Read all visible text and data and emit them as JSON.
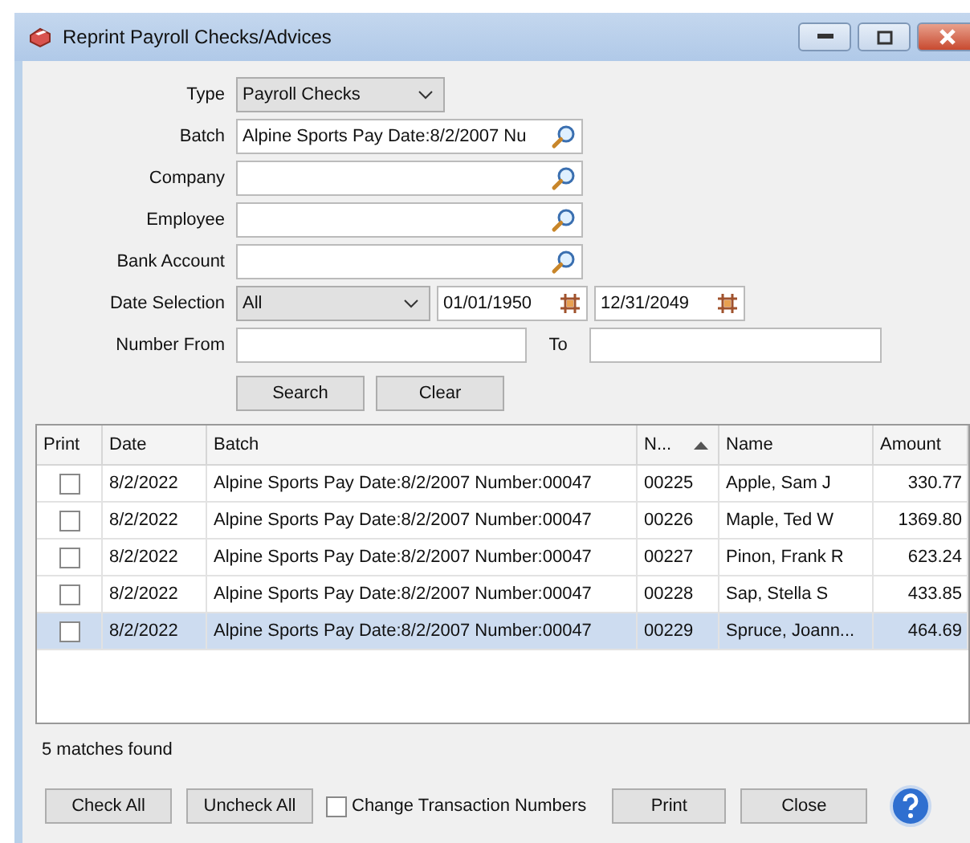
{
  "window": {
    "title": "Reprint Payroll Checks/Advices"
  },
  "form": {
    "type": {
      "label": "Type",
      "value": "Payroll Checks"
    },
    "lookups": [
      {
        "label": "Batch",
        "value": "Alpine Sports Pay Date:8/2/2007 Nu"
      },
      {
        "label": "Company"
      },
      {
        "label": "Employee"
      },
      {
        "label": "Bank Account"
      }
    ],
    "date_selection": {
      "label": "Date Selection",
      "value": "All",
      "from": "01/01/1950",
      "to": "12/31/2049"
    },
    "number": {
      "label": "Number From",
      "to_label": "To"
    },
    "buttons": [
      "Search",
      "Clear"
    ]
  },
  "table": {
    "columns": [
      {
        "label": "Print",
        "sorted": false
      },
      {
        "label": "Date",
        "sorted": false
      },
      {
        "label": "Batch",
        "sorted": false
      },
      {
        "label": "N...",
        "sorted": true
      },
      {
        "label": "Name",
        "sorted": false
      },
      {
        "label": "Amount",
        "sorted": false
      }
    ],
    "rows": [
      {
        "print": false,
        "date": "8/2/2022",
        "batch": "Alpine Sports Pay Date:8/2/2007 Number:00047",
        "number": "00225",
        "name": "Apple, Sam J",
        "amount": "330.77",
        "selected": false
      },
      {
        "print": false,
        "date": "8/2/2022",
        "batch": "Alpine Sports Pay Date:8/2/2007 Number:00047",
        "number": "00226",
        "name": "Maple, Ted W",
        "amount": "1369.80",
        "selected": false
      },
      {
        "print": false,
        "date": "8/2/2022",
        "batch": "Alpine Sports Pay Date:8/2/2007 Number:00047",
        "number": "00227",
        "name": "Pinon, Frank R",
        "amount": "623.24",
        "selected": false
      },
      {
        "print": false,
        "date": "8/2/2022",
        "batch": "Alpine Sports Pay Date:8/2/2007 Number:00047",
        "number": "00228",
        "name": "Sap, Stella S",
        "amount": "433.85",
        "selected": false
      },
      {
        "print": false,
        "date": "8/2/2022",
        "batch": "Alpine Sports Pay Date:8/2/2007 Number:00047",
        "number": "00229",
        "name": "Spruce, Joann...",
        "amount": "464.69",
        "selected": true
      }
    ]
  },
  "status": "5 matches found",
  "footer": {
    "check_all": "Check All",
    "uncheck_all": "Uncheck All",
    "change_numbers": {
      "label": "Change Transaction Numbers",
      "checked": false
    },
    "print": "Print",
    "close": "Close"
  }
}
